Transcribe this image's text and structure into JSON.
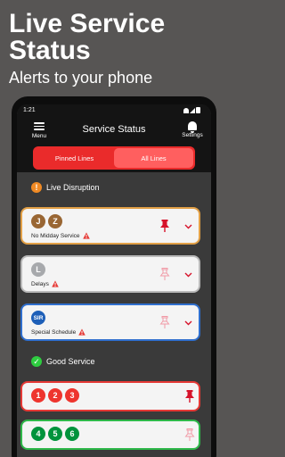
{
  "promo": {
    "headline": "Live Service Status",
    "subheadline": "Alerts to your phone"
  },
  "device": {
    "time": "1:21"
  },
  "appbar": {
    "menu_label": "Menu",
    "title": "Service Status",
    "settings_label": "Settings"
  },
  "tabs": [
    {
      "label": "Pinned Lines",
      "active": false
    },
    {
      "label": "All Lines",
      "active": true
    }
  ],
  "sections": {
    "disruption": {
      "title": "Live Disruption",
      "icon": "exclamation-icon",
      "color": "#f08a24"
    },
    "good": {
      "title": "Good Service",
      "icon": "check-icon",
      "color": "#2ecc40"
    }
  },
  "cards": [
    {
      "lines": [
        "J",
        "Z"
      ],
      "line_color": "#996633",
      "border": "#e2a046",
      "status": "No Midday Service",
      "pinned": true
    },
    {
      "lines": [
        "L"
      ],
      "line_color": "#a7a9ac",
      "border": "#b9b9b9",
      "status": "Delays",
      "pinned": false
    },
    {
      "lines": [
        "SIR"
      ],
      "line_color": "#1d5fb8",
      "border": "#2f6fce",
      "status": "Special Schedule",
      "pinned": false
    },
    {
      "lines": [
        "1",
        "2",
        "3"
      ],
      "line_color": "#ee352e",
      "border": "#e53935",
      "status": "",
      "pinned": true
    },
    {
      "lines": [
        "4",
        "5",
        "6"
      ],
      "line_color": "#00933c",
      "border": "#2eb84a",
      "status": "",
      "pinned": false
    }
  ],
  "colors": {
    "accent_red": "#ea2b2b",
    "pin_active": "#d6122a",
    "pin_inactive": "#f19aa6"
  }
}
